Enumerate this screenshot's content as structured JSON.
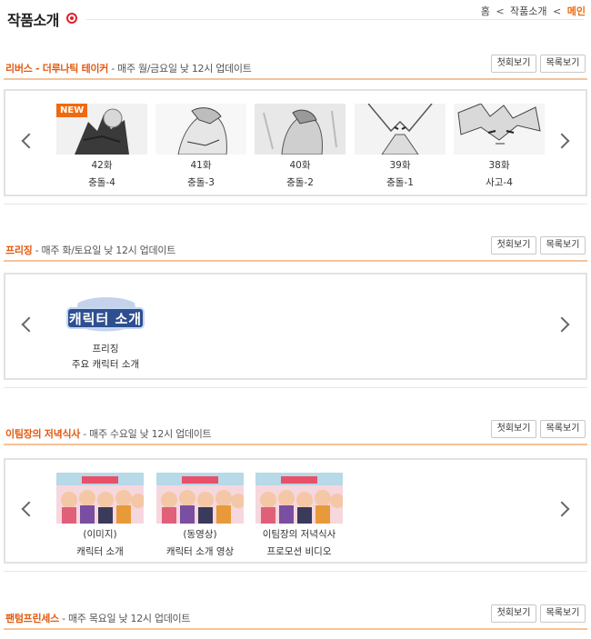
{
  "header": {
    "title": "작품소개",
    "breadcrumb": {
      "home": "홈",
      "sep": "<",
      "section": "작품소개",
      "current": "메인"
    }
  },
  "buttons": {
    "first": "첫회보기",
    "list": "목록보기"
  },
  "series": [
    {
      "name": "리버스 - 더루나틱 테이커",
      "schedule": " - 매주 월/금요일 낮 12시 업데이트",
      "episodes": [
        {
          "num": "42화",
          "title": "충돌-4",
          "badge": "NEW"
        },
        {
          "num": "41화",
          "title": "충돌-3"
        },
        {
          "num": "40화",
          "title": "충돌-2"
        },
        {
          "num": "39화",
          "title": "충돌-1"
        },
        {
          "num": "38화",
          "title": "사고-4"
        }
      ]
    },
    {
      "name": "프리징",
      "schedule": " - 매주 화/토요일 낮 12시 업데이트",
      "items": [
        {
          "logo_text": "캐릭터 소개",
          "line1": "프리징",
          "line2": "주요 캐릭터 소개"
        }
      ]
    },
    {
      "name": "이팀장의 저녁식사",
      "schedule": " - 매주 수요일 낮 12시 업데이트",
      "items": [
        {
          "line1": "(이미지)",
          "line2": "캐릭터 소개"
        },
        {
          "line1": "(동영상)",
          "line2": "캐릭터 소개 영상"
        },
        {
          "line1": "이팀장의 저녁식사",
          "line2": "프로모션 비디오"
        }
      ]
    },
    {
      "name": "팬텀프린세스",
      "schedule": " - 매주 목요일 낮 12시 업데이트"
    }
  ],
  "colors": {
    "accent": "#f06a0f",
    "series_name": "#e05a12",
    "rule": "#f5c298"
  }
}
